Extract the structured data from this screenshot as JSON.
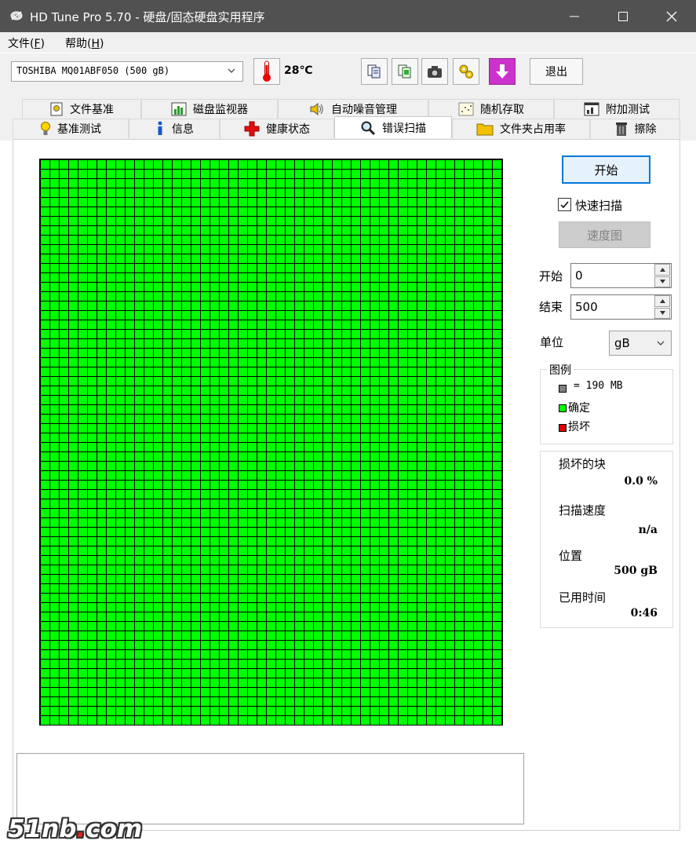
{
  "window": {
    "title": "HD Tune Pro 5.70 - 硬盘/固态硬盘实用程序"
  },
  "menu": {
    "items": [
      {
        "label": "文件(",
        "hotkey": "F",
        "suffix": ")"
      },
      {
        "label": "帮助(",
        "hotkey": "H",
        "suffix": ")"
      }
    ]
  },
  "toolbar": {
    "drive": "TOSHIBA MQ01ABF050 (500 gB)",
    "temperature": "28℃",
    "exit_label": "退出"
  },
  "tabs": {
    "row1": [
      "文件基准",
      "磁盘监视器",
      "自动噪音管理",
      "随机存取",
      "附加测试"
    ],
    "row2": [
      "基准测试",
      "信息",
      "健康状态",
      "错误扫描",
      "文件夹占用率",
      "擦除"
    ],
    "active": "错误扫描"
  },
  "scan": {
    "start_label": "开始",
    "quick_scan_label": "快速扫描",
    "quick_scan_checked": true,
    "speed_map_label": "速度图",
    "start_field_label": "开始",
    "start_value": "0",
    "end_field_label": "结束",
    "end_value": "500",
    "unit_label": "单位",
    "unit_value": "gB"
  },
  "legend": {
    "title": "图例",
    "block_size": "= 190 MB",
    "ok_label": "确定",
    "damaged_label": "损坏",
    "colors": {
      "block": "#808080",
      "ok": "#00ff00",
      "damaged": "#e00000"
    }
  },
  "stats": {
    "damaged_blocks_label": "损坏的块",
    "damaged_blocks_value": "0.0 %",
    "scan_speed_label": "扫描速度",
    "scan_speed_value": "n/a",
    "position_label": "位置",
    "position_value": "500 gB",
    "elapsed_label": "已用时间",
    "elapsed_value": "0:46"
  },
  "grid": {
    "block_color": "#00ff00",
    "status": "all blocks ok"
  },
  "watermark": {
    "part1": "51nb",
    "dot": ".",
    "part2": "com"
  }
}
